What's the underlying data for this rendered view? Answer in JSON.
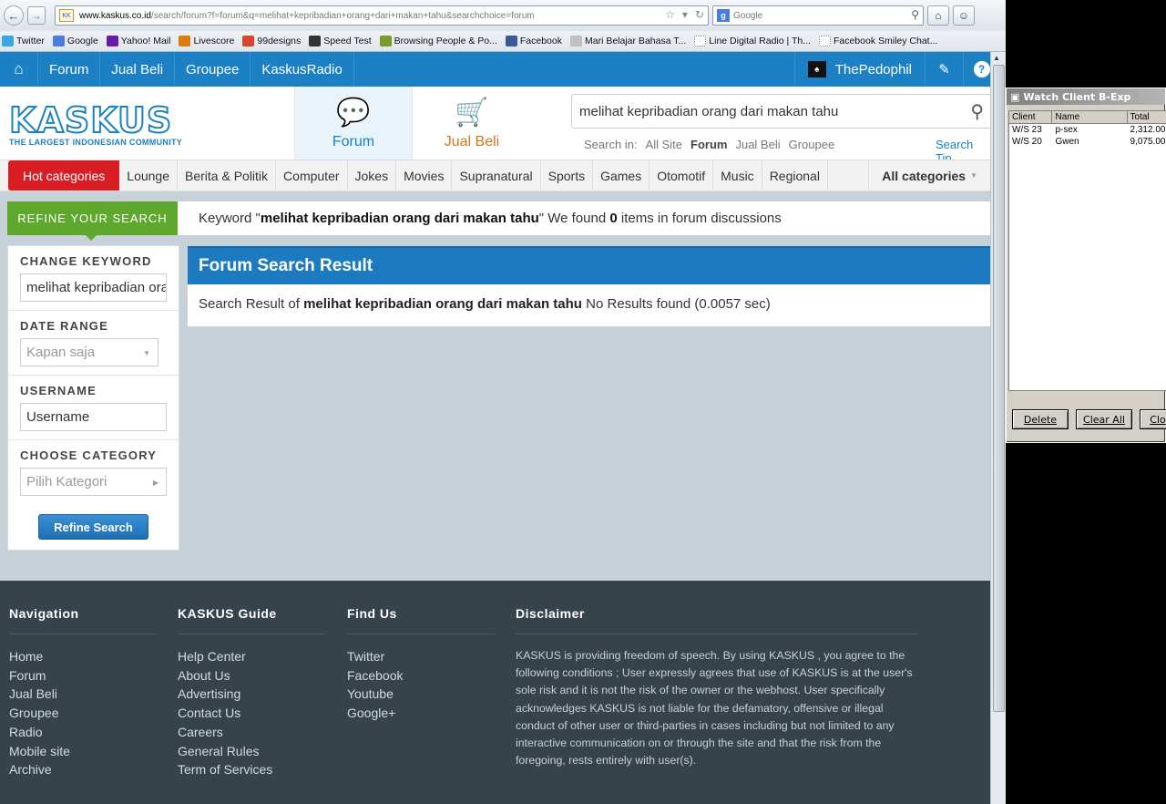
{
  "browser": {
    "url_domain": "www.kaskus.co.id",
    "url_rest": "/search/forum?f=forum&q=melihat+kepribadian+orang+dari+makan+tahu&searchchoice=forum",
    "search_engine_placeholder": "Google",
    "bookmarks": [
      {
        "label": "Twitter",
        "icon": "twitter-icon",
        "color": "#3aa4e6"
      },
      {
        "label": "Google",
        "icon": "google-icon",
        "color": "#4a7de0"
      },
      {
        "label": "Yahoo! Mail",
        "icon": "yahoo-icon",
        "color": "#6b1aa6"
      },
      {
        "label": "Livescore",
        "icon": "livescore-icon",
        "color": "#e07b10"
      },
      {
        "label": "99designs",
        "icon": "99designs-icon",
        "color": "#d9452b"
      },
      {
        "label": "Speed Test",
        "icon": "speedtest-icon",
        "color": "#333333"
      },
      {
        "label": "Browsing People & Po...",
        "icon": "page-icon",
        "color": "#7a9a2a"
      },
      {
        "label": "Facebook",
        "icon": "facebook-icon",
        "color": "#3b5998"
      },
      {
        "label": "Mari Belajar Bahasa T...",
        "icon": "page-icon",
        "color": "#c0c0c0"
      },
      {
        "label": "Line Digital Radio | Th...",
        "icon": "blank-page-icon",
        "color": "#ffffff"
      },
      {
        "label": "Facebook Smiley Chat...",
        "icon": "blank-page-icon",
        "color": "#ffffff"
      }
    ]
  },
  "topnav": {
    "items": [
      "Forum",
      "Jual Beli",
      "Groupee",
      "KaskusRadio"
    ],
    "username": "ThePedophil"
  },
  "header": {
    "logo_text": "KASKUS",
    "logo_tagline": "THE LARGEST INDONESIAN COMMUNITY",
    "tab_forum": "Forum",
    "tab_jualbeli": "Jual Beli",
    "search_value": "melihat kepribadian orang dari makan tahu",
    "search_in_label": "Search in:",
    "search_in_options": [
      "All Site",
      "Forum",
      "Jual Beli",
      "Groupee"
    ],
    "search_tips": "Search Tip"
  },
  "categories": {
    "hot": "Hot categories",
    "items": [
      "Lounge",
      "Berita & Politik",
      "Computer",
      "Jokes",
      "Movies",
      "Supranatural",
      "Sports",
      "Games",
      "Otomotif",
      "Music",
      "Regional"
    ],
    "all": "All categories"
  },
  "refine": {
    "tag": "REFINE YOUR SEARCH",
    "msg_prefix": "Keyword \"",
    "keyword": "melihat kepribadian orang dari makan tahu",
    "msg_middle": "\" We found ",
    "count": "0",
    "msg_suffix": " items in forum discussions"
  },
  "sidebar": {
    "change_keyword_label": "CHANGE KEYWORD",
    "keyword_value": "melihat kepribadian orang dari makan tahu",
    "date_range_label": "DATE RANGE",
    "date_range_value": "Kapan saja",
    "username_label": "USERNAME",
    "username_placeholder": "Username",
    "category_label": "CHOOSE CATEGORY",
    "category_value": "Pilih Kategori",
    "button": "Refine Search"
  },
  "results": {
    "title": "Forum Search Result",
    "prefix": "Search Result of ",
    "query": "melihat kepribadian orang dari makan tahu",
    "suffix": " No Results found (0.0057 sec)"
  },
  "footer": {
    "navigation": {
      "title": "Navigation",
      "links": [
        "Home",
        "Forum",
        "Jual Beli",
        "Groupee",
        "Radio",
        "Mobile site",
        "Archive"
      ]
    },
    "guide": {
      "title": "KASKUS Guide",
      "links": [
        "Help Center",
        "About Us",
        "Advertising",
        "Contact Us",
        "Careers",
        "General Rules",
        "Term of Services"
      ]
    },
    "findus": {
      "title": "Find Us",
      "links": [
        "Twitter",
        "Facebook",
        "Youtube",
        "Google+"
      ]
    },
    "disclaimer": {
      "title": "Disclaimer",
      "text": "KASKUS is providing freedom of speech. By using KASKUS , you agree to the following conditions ; User expressly agrees that use of KASKUS is at the user's sole risk and it is not the risk of the owner or the webhost. User specifically acknowledges KASKUS is not liable for the defamatory, offensive or illegal conduct of other user or third-parties in cases including but not limited to any interactive communication on or through the site and that the risk from the foregoing, rests entirely with user(s)."
    }
  },
  "watch_window": {
    "title": "Watch Client B-Exp",
    "columns": [
      "Client",
      "Name",
      "Total"
    ],
    "rows": [
      {
        "client": "W/S 23",
        "name": "p-sex",
        "total": "2,312.00"
      },
      {
        "client": "W/S 20",
        "name": "Gwen",
        "total": "9,075.00"
      }
    ],
    "buttons": [
      "Delete",
      "Clear All",
      "Clo"
    ]
  }
}
